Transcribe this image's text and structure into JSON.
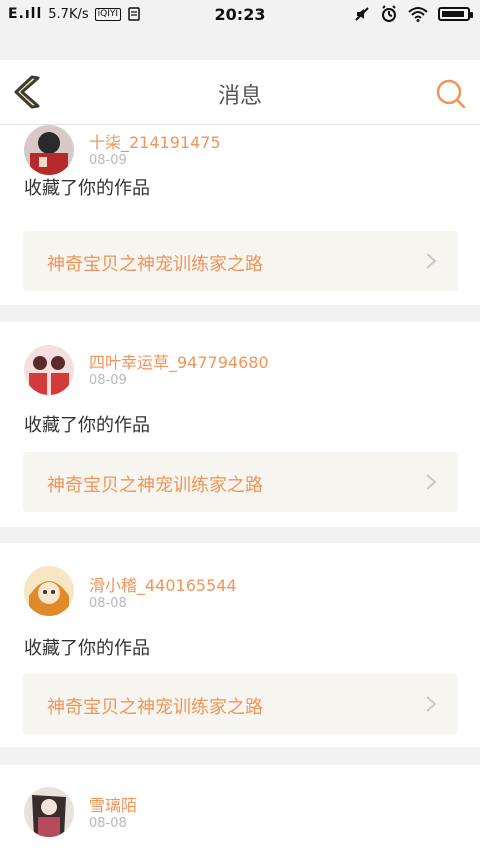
{
  "status_bar": {
    "carrier": "E.ıll",
    "speed": "5.7K/s",
    "badge_text": "iQIYI",
    "time": "20:23",
    "icons": [
      "muted-icon",
      "alarm-icon",
      "wifi-icon",
      "battery-icon"
    ]
  },
  "header": {
    "title": "消息",
    "back_icon": "back-chevron-icon",
    "search_icon": "search-icon"
  },
  "colors": {
    "accent": "#f0955a",
    "back_chevron_fill": "#f7e98a",
    "back_chevron_stroke": "#3b3b3b",
    "card_bg": "#ffffff",
    "page_bg": "#f2f2f2",
    "work_link_bg": "#f6f5ef"
  },
  "messages": [
    {
      "username": "十柒_214191475",
      "date": "08-09",
      "action": "收藏了你的作品",
      "work_title": "神奇宝贝之神宠训练家之路"
    },
    {
      "username": "四叶幸运草_947794680",
      "date": "08-09",
      "action": "收藏了你的作品",
      "work_title": "神奇宝贝之神宠训练家之路"
    },
    {
      "username": "滑小稽_440165544",
      "date": "08-08",
      "action": "收藏了你的作品",
      "work_title": "神奇宝贝之神宠训练家之路"
    },
    {
      "username": "雪璃陌",
      "date": "08-08",
      "action": "",
      "work_title": ""
    }
  ]
}
